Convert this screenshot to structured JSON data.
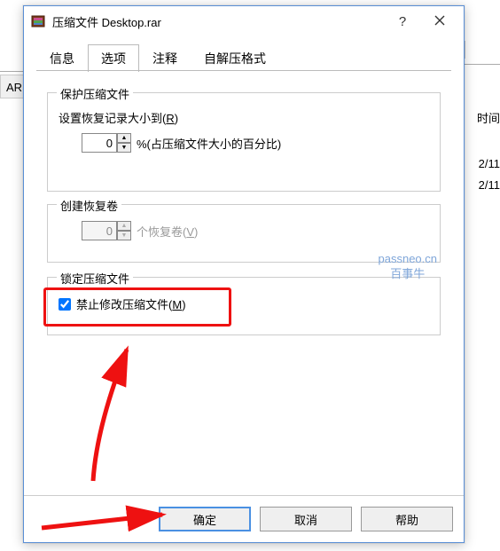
{
  "background": {
    "left_fragment": "AR 压",
    "right_label": "时间",
    "date1": "2/11",
    "date2": "2/11"
  },
  "dialog": {
    "title": "压缩文件 Desktop.rar",
    "tabs": [
      "信息",
      "选项",
      "注释",
      "自解压格式"
    ],
    "active_tab": 1
  },
  "group_protect": {
    "legend": "保护压缩文件",
    "label": "设置恢复记录大小到",
    "hotkey": "R",
    "value": "0",
    "suffix": "%(占压缩文件大小的百分比)"
  },
  "group_volume": {
    "legend": "创建恢复卷",
    "value": "0",
    "suffix": "个恢复卷",
    "hotkey": "V",
    "disabled": true
  },
  "group_lock": {
    "legend": "锁定压缩文件",
    "checkbox_label": "禁止修改压缩文件",
    "hotkey": "M",
    "checked": true
  },
  "buttons": {
    "ok": "确定",
    "cancel": "取消",
    "help": "帮助"
  },
  "watermark": {
    "line1": "passneo.cn",
    "line2": "百事牛"
  }
}
